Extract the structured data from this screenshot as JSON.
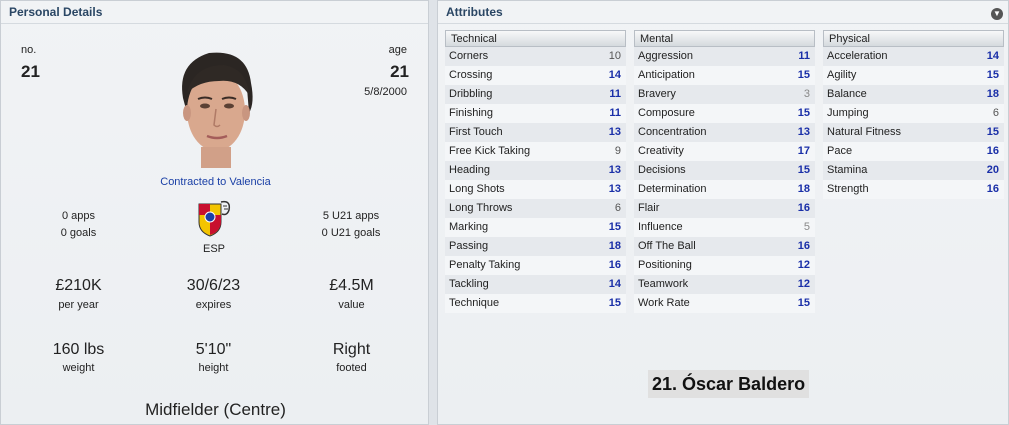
{
  "personal": {
    "title": "Personal Details",
    "no_label": "no.",
    "no_value": "21",
    "age_label": "age",
    "age_value": "21",
    "dob": "5/8/2000",
    "contract": "Contracted to Valencia",
    "apps": "0 apps",
    "goals": "0 goals",
    "nation": "ESP",
    "u21_apps": "5 U21 apps",
    "u21_goals": "0 U21 goals",
    "wage": "£210K",
    "wage_label": "per year",
    "expires": "30/6/23",
    "expires_label": "expires",
    "value": "£4.5M",
    "value_label": "value",
    "weight": "160 lbs",
    "weight_label": "weight",
    "height": "5'10\"",
    "height_label": "height",
    "foot": "Right",
    "foot_label": "footed",
    "position": "Midfielder (Centre)"
  },
  "attributes": {
    "title": "Attributes",
    "player_name": "21. Óscar Baldero",
    "technical": {
      "header": "Technical",
      "rows": [
        {
          "name": "Corners",
          "value": "10"
        },
        {
          "name": "Crossing",
          "value": "14"
        },
        {
          "name": "Dribbling",
          "value": "11"
        },
        {
          "name": "Finishing",
          "value": "11"
        },
        {
          "name": "First Touch",
          "value": "13"
        },
        {
          "name": "Free Kick Taking",
          "value": "9"
        },
        {
          "name": "Heading",
          "value": "13"
        },
        {
          "name": "Long Shots",
          "value": "13"
        },
        {
          "name": "Long Throws",
          "value": "6"
        },
        {
          "name": "Marking",
          "value": "15"
        },
        {
          "name": "Passing",
          "value": "18"
        },
        {
          "name": "Penalty Taking",
          "value": "16"
        },
        {
          "name": "Tackling",
          "value": "14"
        },
        {
          "name": "Technique",
          "value": "15"
        }
      ]
    },
    "mental": {
      "header": "Mental",
      "rows": [
        {
          "name": "Aggression",
          "value": "11"
        },
        {
          "name": "Anticipation",
          "value": "15"
        },
        {
          "name": "Bravery",
          "value": "3"
        },
        {
          "name": "Composure",
          "value": "15"
        },
        {
          "name": "Concentration",
          "value": "13"
        },
        {
          "name": "Creativity",
          "value": "17"
        },
        {
          "name": "Decisions",
          "value": "15"
        },
        {
          "name": "Determination",
          "value": "18"
        },
        {
          "name": "Flair",
          "value": "16"
        },
        {
          "name": "Influence",
          "value": "5"
        },
        {
          "name": "Off The Ball",
          "value": "16"
        },
        {
          "name": "Positioning",
          "value": "12"
        },
        {
          "name": "Teamwork",
          "value": "12"
        },
        {
          "name": "Work Rate",
          "value": "15"
        }
      ]
    },
    "physical": {
      "header": "Physical",
      "rows": [
        {
          "name": "Acceleration",
          "value": "14"
        },
        {
          "name": "Agility",
          "value": "15"
        },
        {
          "name": "Balance",
          "value": "18"
        },
        {
          "name": "Jumping",
          "value": "6"
        },
        {
          "name": "Natural Fitness",
          "value": "15"
        },
        {
          "name": "Pace",
          "value": "16"
        },
        {
          "name": "Stamina",
          "value": "20"
        },
        {
          "name": "Strength",
          "value": "16"
        }
      ]
    }
  },
  "colors": {
    "high_value": "#1a2fa8",
    "mid_value": "#555555",
    "low_value": "#888888",
    "link": "#1a3fa6"
  }
}
